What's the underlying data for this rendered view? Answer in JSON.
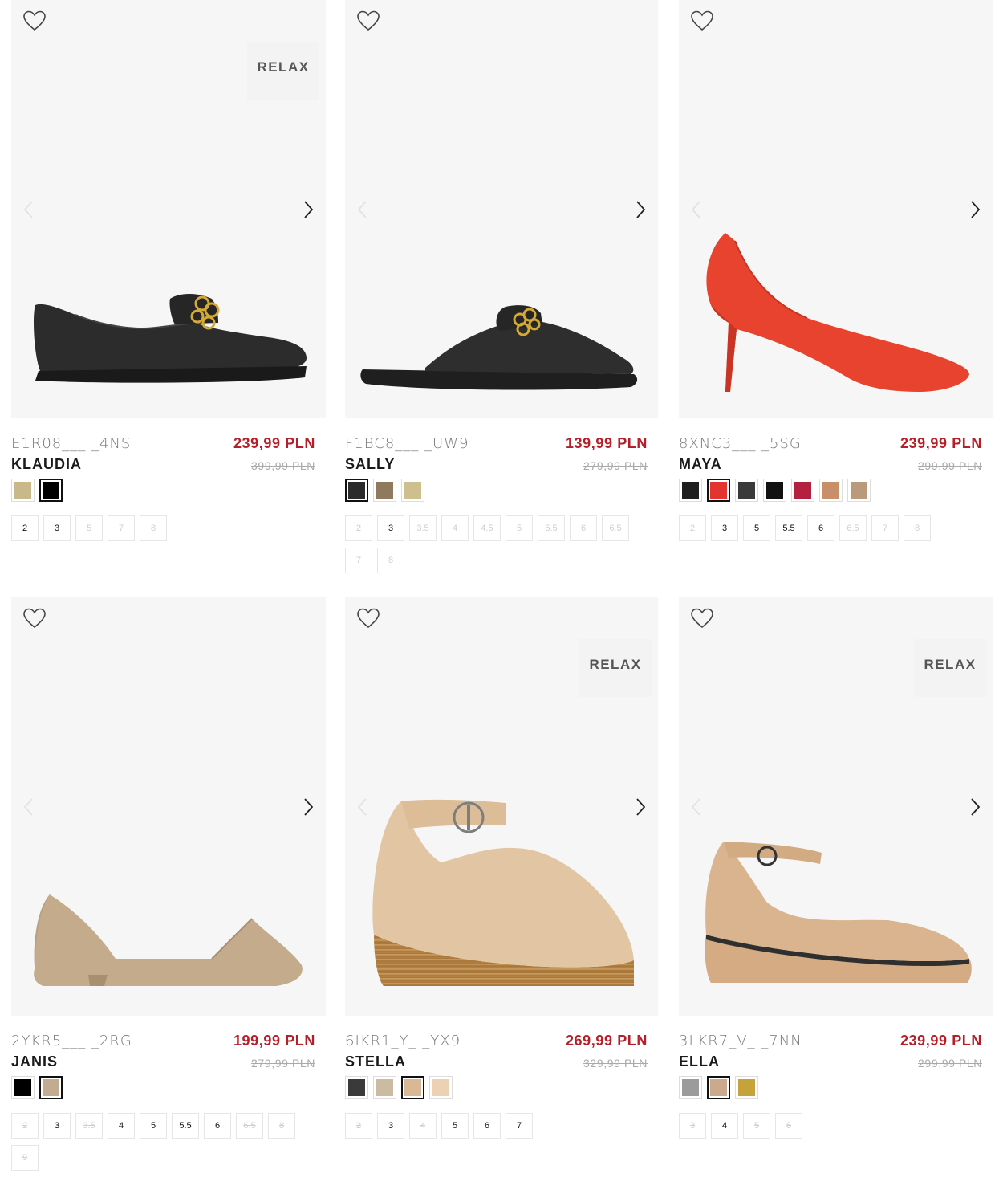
{
  "products": [
    {
      "sku": "E1R08___ _4NS",
      "name": "KLAUDIA",
      "price": "239,99 PLN",
      "old_price": "399,99 PLN",
      "badge": "RELAX",
      "image": "black-chain-loafer",
      "colors": [
        {
          "hex": "#c8b88a",
          "selected": false
        },
        {
          "hex": "#000000",
          "selected": true
        }
      ],
      "sizes": [
        {
          "label": "2",
          "available": true
        },
        {
          "label": "3",
          "available": true
        },
        {
          "label": "5",
          "available": false
        },
        {
          "label": "7",
          "available": false
        },
        {
          "label": "8",
          "available": false
        }
      ]
    },
    {
      "sku": "F1BC8___ _UW9",
      "name": "SALLY",
      "price": "139,99 PLN",
      "old_price": "279,99 PLN",
      "badge": "",
      "image": "black-chain-mule",
      "colors": [
        {
          "hex": "#2b2b2b",
          "selected": true
        },
        {
          "hex": "#8f7a5e",
          "selected": false
        },
        {
          "hex": "#cdbf8e",
          "selected": false
        }
      ],
      "sizes": [
        {
          "label": "2",
          "available": false
        },
        {
          "label": "3",
          "available": true
        },
        {
          "label": "3.5",
          "available": false
        },
        {
          "label": "4",
          "available": false
        },
        {
          "label": "4.5",
          "available": false
        },
        {
          "label": "5",
          "available": false
        },
        {
          "label": "5.5",
          "available": false
        },
        {
          "label": "6",
          "available": false
        },
        {
          "label": "6.5",
          "available": false
        },
        {
          "label": "7",
          "available": false
        },
        {
          "label": "8",
          "available": false
        }
      ]
    },
    {
      "sku": "8XNC3___ _5SG",
      "name": "MAYA",
      "price": "239,99 PLN",
      "old_price": "299,99 PLN",
      "badge": "",
      "image": "red-stiletto-pump",
      "colors": [
        {
          "hex": "#1e1e1e",
          "selected": false
        },
        {
          "hex": "#e3342f",
          "selected": true
        },
        {
          "hex": "#3a3a3a",
          "selected": false
        },
        {
          "hex": "#111111",
          "selected": false
        },
        {
          "hex": "#b4203f",
          "selected": false
        },
        {
          "hex": "#c98f69",
          "selected": false
        },
        {
          "hex": "#b99a7b",
          "selected": false
        }
      ],
      "sizes": [
        {
          "label": "2",
          "available": false
        },
        {
          "label": "3",
          "available": true
        },
        {
          "label": "5",
          "available": true
        },
        {
          "label": "5.5",
          "available": true
        },
        {
          "label": "6",
          "available": true
        },
        {
          "label": "6.5",
          "available": false
        },
        {
          "label": "7",
          "available": false
        },
        {
          "label": "8",
          "available": false
        }
      ]
    },
    {
      "sku": "2YKR5___ _2RG",
      "name": "JANIS",
      "price": "199,99 PLN",
      "old_price": "279,99 PLN",
      "badge": "",
      "image": "beige-dorsay-flat",
      "colors": [
        {
          "hex": "#000000",
          "selected": false
        },
        {
          "hex": "#c2ab8e",
          "selected": true
        }
      ],
      "sizes": [
        {
          "label": "2",
          "available": false
        },
        {
          "label": "3",
          "available": true
        },
        {
          "label": "3.5",
          "available": false
        },
        {
          "label": "4",
          "available": true
        },
        {
          "label": "5",
          "available": true
        },
        {
          "label": "5.5",
          "available": true
        },
        {
          "label": "6",
          "available": true
        },
        {
          "label": "6.5",
          "available": false
        },
        {
          "label": "8",
          "available": false
        },
        {
          "label": "9",
          "available": false
        }
      ]
    },
    {
      "sku": "6IKR1_Y_ _YX9",
      "name": "STELLA",
      "price": "269,99 PLN",
      "old_price": "329,99 PLN",
      "badge": "RELAX",
      "image": "beige-espadrille-wedge",
      "colors": [
        {
          "hex": "#3a3a3a",
          "selected": false
        },
        {
          "hex": "#cbbba1",
          "selected": false
        },
        {
          "hex": "#d9b896",
          "selected": true
        },
        {
          "hex": "#ecd1b5",
          "selected": false
        }
      ],
      "sizes": [
        {
          "label": "2",
          "available": false
        },
        {
          "label": "3",
          "available": true
        },
        {
          "label": "4",
          "available": false
        },
        {
          "label": "5",
          "available": true
        },
        {
          "label": "6",
          "available": true
        },
        {
          "label": "7",
          "available": true
        }
      ]
    },
    {
      "sku": "3LKR7_V_ _7NN",
      "name": "ELLA",
      "price": "239,99 PLN",
      "old_price": "299,99 PLN",
      "badge": "RELAX",
      "image": "beige-ankle-strap-wedge",
      "colors": [
        {
          "hex": "#9b9b9b",
          "selected": false
        },
        {
          "hex": "#cba98c",
          "selected": true
        },
        {
          "hex": "#c6a23b",
          "selected": false
        }
      ],
      "sizes": [
        {
          "label": "3",
          "available": false
        },
        {
          "label": "4",
          "available": true
        },
        {
          "label": "5",
          "available": false
        },
        {
          "label": "6",
          "available": false
        }
      ]
    }
  ]
}
